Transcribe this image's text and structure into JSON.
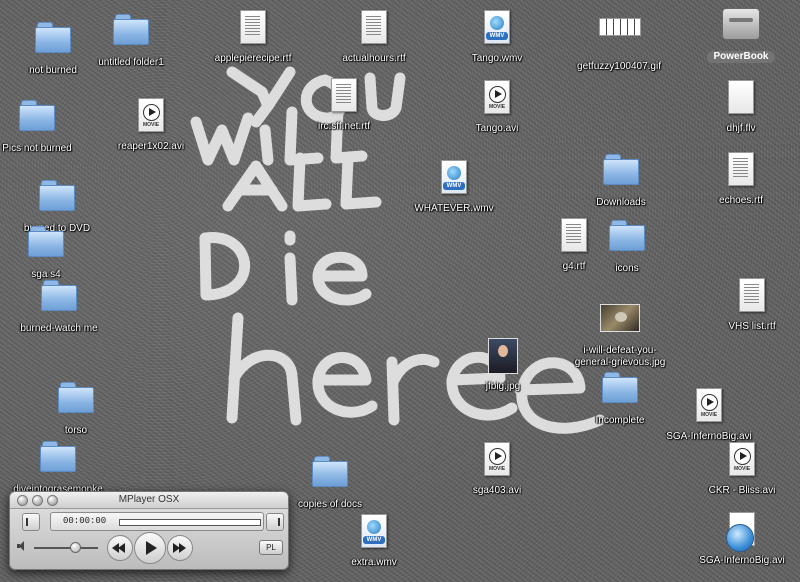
{
  "desktop": {
    "graffiti": [
      "You",
      "Will",
      "All",
      "Die",
      "here"
    ],
    "icons": [
      {
        "id": "not-burned",
        "label": "not burned",
        "kind": "folder"
      },
      {
        "id": "untitled-folder1",
        "label": "untitled folder1",
        "kind": "folder"
      },
      {
        "id": "applepierecipe",
        "label": "applepierecipe.rtf",
        "kind": "rtf"
      },
      {
        "id": "actualhours",
        "label": "actualhours.rtf",
        "kind": "rtf"
      },
      {
        "id": "tango-wmv",
        "label": "Tango.wmv",
        "kind": "wmv"
      },
      {
        "id": "getfuzzy",
        "label": "getfuzzy100407.gif",
        "kind": "gif"
      },
      {
        "id": "powerbook",
        "label": "PowerBook",
        "kind": "drive"
      },
      {
        "id": "pics-not-burned",
        "label": "Pics not burned",
        "kind": "folder"
      },
      {
        "id": "reaper",
        "label": "reaper1x02.avi",
        "kind": "movie"
      },
      {
        "id": "irc-sff",
        "label": "irc.sff.net.rtf",
        "kind": "rtf"
      },
      {
        "id": "tango-avi",
        "label": "Tango.avi",
        "kind": "movie"
      },
      {
        "id": "dhjf",
        "label": "dhjf.flv",
        "kind": "blank"
      },
      {
        "id": "downloads",
        "label": "Downloads",
        "kind": "folder"
      },
      {
        "id": "echoes",
        "label": "echoes.rtf",
        "kind": "rtf"
      },
      {
        "id": "burned-to-dvd",
        "label": "burned to DVD",
        "kind": "folder"
      },
      {
        "id": "whatever",
        "label": "WHATEVER.wmv",
        "kind": "wmv"
      },
      {
        "id": "sga-s4",
        "label": "sga s4",
        "kind": "folder"
      },
      {
        "id": "g4",
        "label": "g4.rtf",
        "kind": "rtf"
      },
      {
        "id": "icons",
        "label": "icons",
        "kind": "folder"
      },
      {
        "id": "burned-watch-me",
        "label": "burned-watch me",
        "kind": "folder"
      },
      {
        "id": "defeat-grievous",
        "label": "i-will-defeat-you-\ngeneral-grievous.jpg",
        "kind": "photo-wide"
      },
      {
        "id": "vhs-list",
        "label": "VHS list.rtf",
        "kind": "rtf"
      },
      {
        "id": "jfbig",
        "label": "jfbig.jpg",
        "kind": "photo"
      },
      {
        "id": "torso",
        "label": "torso",
        "kind": "folder"
      },
      {
        "id": "incomplete",
        "label": "Incomplete",
        "kind": "folder"
      },
      {
        "id": "sga-inferno-avi",
        "label": "SGA-InfernoBig.avi",
        "kind": "movie"
      },
      {
        "id": "diveintogrease",
        "label": "diveintograsemonke",
        "kind": "folder"
      },
      {
        "id": "sga403",
        "label": "sga403.avi",
        "kind": "movie"
      },
      {
        "id": "copies-of-docs",
        "label": "copies of docs",
        "kind": "folder"
      },
      {
        "id": "ckr-bliss",
        "label": "CKR - Bliss.avi",
        "kind": "movie"
      },
      {
        "id": "extra-wmv",
        "label": "extra.wmv",
        "kind": "wmv"
      },
      {
        "id": "sga-inferno-divx",
        "label": "SGA-InfernoBig.avi",
        "kind": "quicktime"
      }
    ]
  },
  "mplayer": {
    "title": "MPlayer OSX",
    "time": "00:00:00",
    "playlist_label": "PL",
    "progress": 0,
    "volume": 0.58
  }
}
